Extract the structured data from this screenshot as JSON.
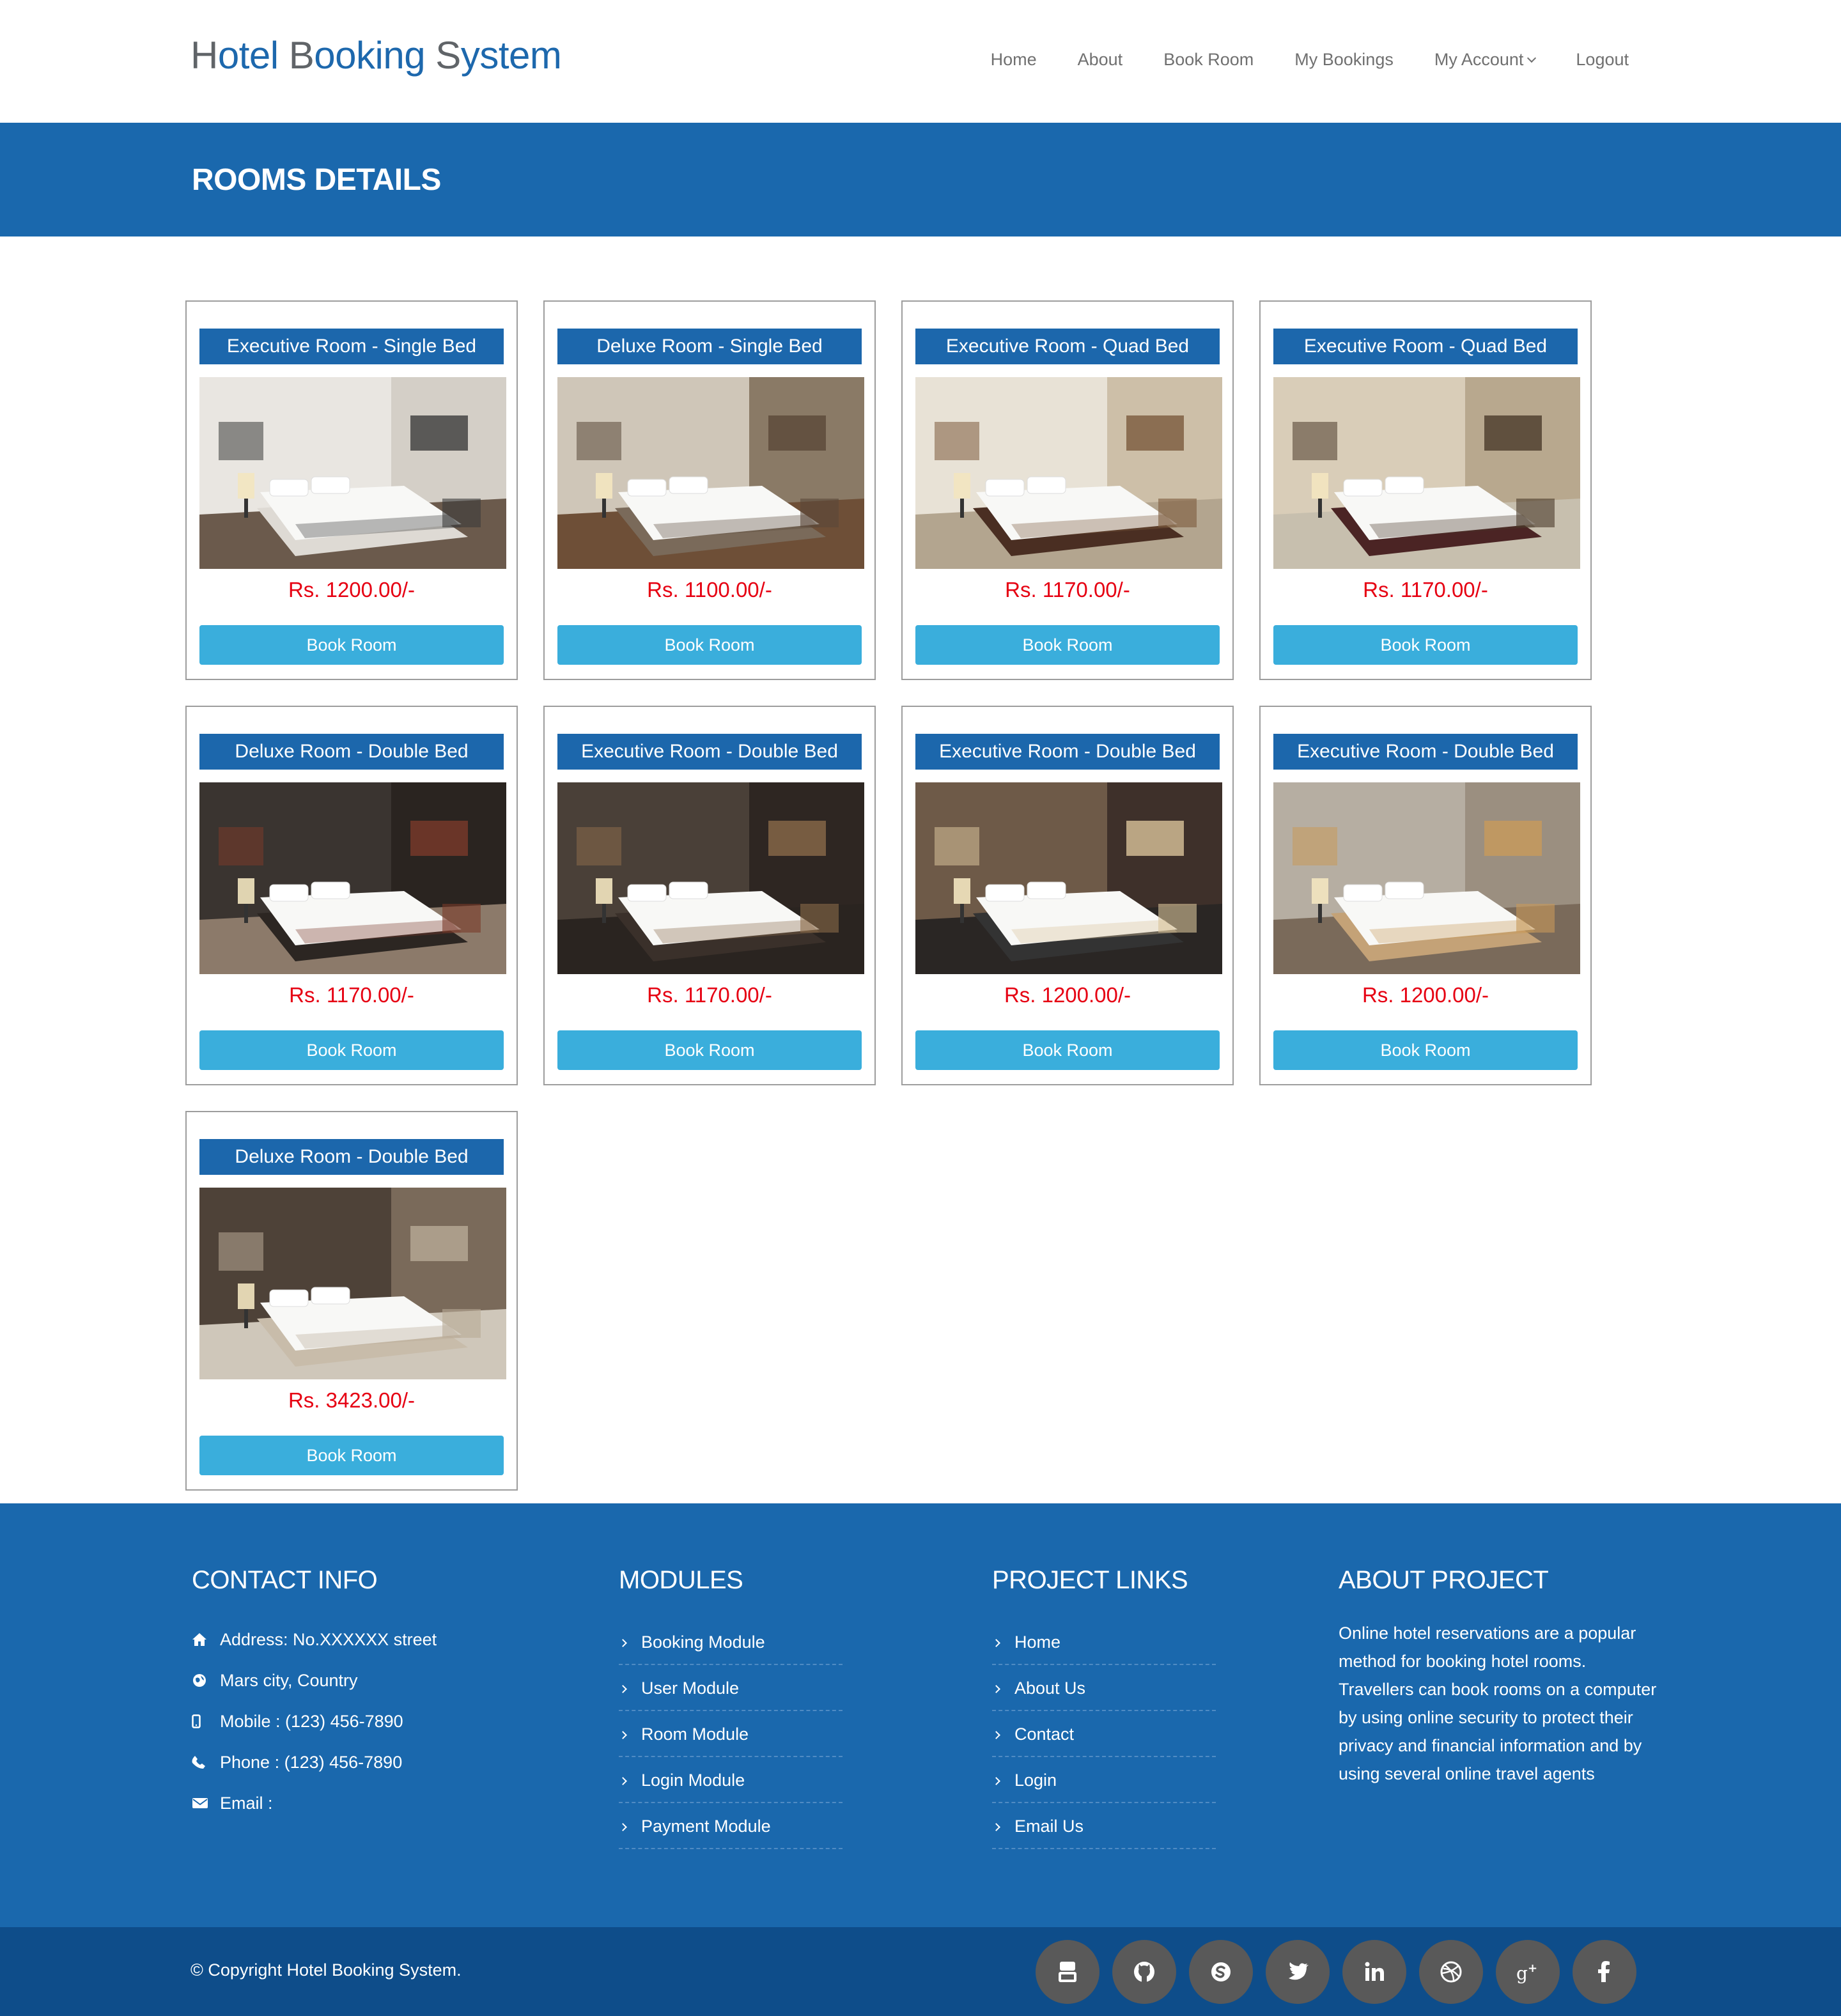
{
  "header": {
    "brand": "Hotel Booking System",
    "nav": [
      "Home",
      "About",
      "Book Room",
      "My Bookings",
      "My Account",
      "Logout"
    ]
  },
  "page_title": "ROOMS DETAILS",
  "rooms": [
    {
      "title": "Executive Room - Single Bed",
      "price": "Rs. 1200.00/-",
      "button": "Book Room"
    },
    {
      "title": "Deluxe Room - Single Bed",
      "price": "Rs. 1100.00/-",
      "button": "Book Room"
    },
    {
      "title": "Executive Room - Quad Bed",
      "price": "Rs. 1170.00/-",
      "button": "Book Room"
    },
    {
      "title": "Executive Room - Quad Bed",
      "price": "Rs. 1170.00/-",
      "button": "Book Room"
    },
    {
      "title": "Deluxe Room - Double Bed",
      "price": "Rs. 1170.00/-",
      "button": "Book Room"
    },
    {
      "title": "Executive Room - Double Bed",
      "price": "Rs. 1170.00/-",
      "button": "Book Room"
    },
    {
      "title": "Executive Room - Double Bed",
      "price": "Rs. 1200.00/-",
      "button": "Book Room"
    },
    {
      "title": "Executive Room - Double Bed",
      "price": "Rs. 1200.00/-",
      "button": "Book Room"
    },
    {
      "title": "Deluxe Room - Double Bed",
      "price": "Rs. 3423.00/-",
      "button": "Book Room"
    }
  ],
  "footer": {
    "contact": {
      "heading": "CONTACT INFO",
      "items": [
        {
          "icon": "home-icon",
          "text": "Address: No.XXXXXX street"
        },
        {
          "icon": "globe-icon",
          "text": "Mars city, Country"
        },
        {
          "icon": "mobile-icon",
          "text": "Mobile : (123) 456-7890"
        },
        {
          "icon": "phone-icon",
          "text": "Phone : (123) 456-7890"
        },
        {
          "icon": "envelope-icon",
          "text": "Email :"
        }
      ]
    },
    "modules": {
      "heading": "MODULES",
      "items": [
        "Booking Module",
        "User Module",
        "Room Module",
        "Login Module",
        "Payment Module"
      ]
    },
    "project_links": {
      "heading": "PROJECT LINKS",
      "items": [
        "Home",
        "About Us",
        "Contact",
        "Login",
        "Email Us"
      ]
    },
    "about": {
      "heading": "ABOUT PROJECT",
      "text": "Online hotel reservations are a popular method for booking hotel rooms. Travellers can book rooms on a computer by using online security to protect their privacy and financial information and by using several online travel agents"
    }
  },
  "bottom": {
    "copyright": "© Copyright Hotel Booking System.",
    "socials": [
      "youtube-icon",
      "github-icon",
      "skype-icon",
      "twitter-icon",
      "linkedin-icon",
      "dribbble-icon",
      "google-plus-icon",
      "facebook-icon"
    ]
  },
  "colors": {
    "primary_blue": "#1a68ad",
    "dark_blue": "#0e4d8a",
    "button_blue": "#3aaedc",
    "price_red": "#e60012"
  }
}
